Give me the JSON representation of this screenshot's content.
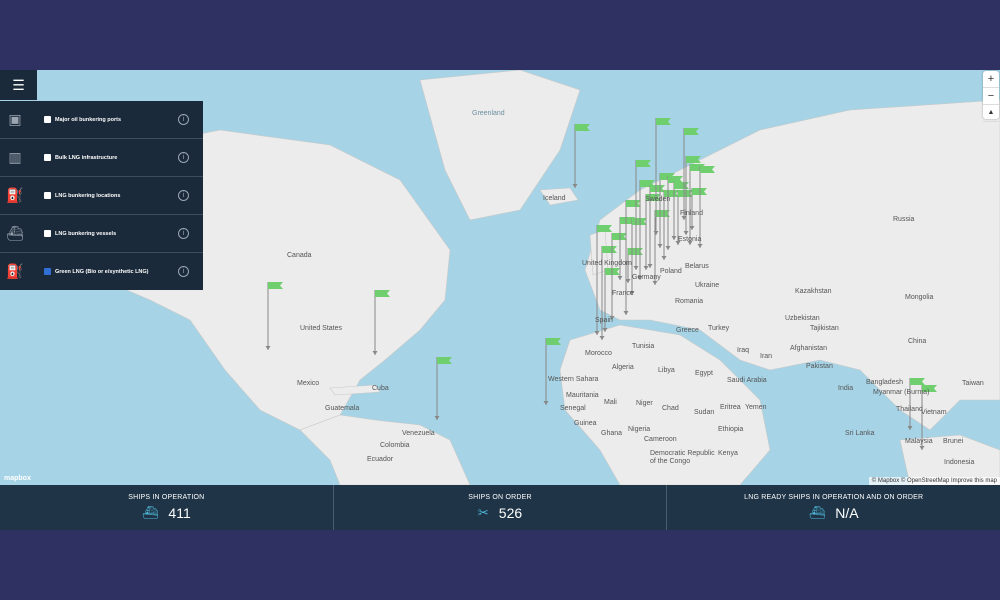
{
  "menu_icon": "hamburger-icon",
  "layers": [
    {
      "icon": "oil-port-icon",
      "label": "Major oil bunkering ports",
      "checked": false,
      "color": "#9aa5b1"
    },
    {
      "icon": "lng-infrastructure-icon",
      "label": "Bulk LNG infrastructure",
      "checked": false,
      "color": "#9aa5b1"
    },
    {
      "icon": "fuel-pump-icon",
      "label": "LNG bunkering locations",
      "checked": false,
      "color": "#9aa5b1"
    },
    {
      "icon": "ship-icon",
      "label": "LNG bunkering vessels",
      "checked": false,
      "color": "#9aa5b1"
    },
    {
      "icon": "green-fuel-pump-icon",
      "label": "Green LNG (Bio or e/synthetic LNG)",
      "checked": true,
      "color": "#4cd864"
    }
  ],
  "zoom": {
    "in": "+",
    "out": "−",
    "reset": "▲"
  },
  "map_labels": {
    "greenland": "Greenland",
    "iceland": "Iceland",
    "canada": "Canada",
    "united_states": "United States",
    "mexico": "Mexico",
    "guatemala": "Guatemala",
    "cuba": "Cuba",
    "venezuela": "Venezuela",
    "colombia": "Colombia",
    "ecuador": "Ecuador",
    "russia": "Russia",
    "finland": "Finland",
    "sweden": "Sweden",
    "estonia": "Estonia",
    "belarus": "Belarus",
    "poland": "Poland",
    "germany": "Germany",
    "france": "France",
    "spain": "Spain",
    "united_kingdom": "United Kingdom",
    "ukraine": "Ukraine",
    "romania": "Romania",
    "greece": "Greece",
    "turkey": "Turkey",
    "kazakhstan": "Kazakhstan",
    "mongolia": "Mongolia",
    "uzbekistan": "Uzbekistan",
    "tajikistan": "Tajikistan",
    "afghanistan": "Afghanistan",
    "pakistan": "Pakistan",
    "china": "China",
    "iraq": "Iraq",
    "iran": "Iran",
    "saudi_arabia": "Saudi Arabia",
    "egypt": "Egypt",
    "libya": "Libya",
    "algeria": "Algeria",
    "tunisia": "Tunisia",
    "morocco": "Morocco",
    "western_sahara": "Western Sahara",
    "mauritania": "Mauritania",
    "mali": "Mali",
    "niger": "Niger",
    "chad": "Chad",
    "sudan": "Sudan",
    "eritrea": "Eritrea",
    "yemen": "Yemen",
    "ethiopia": "Ethiopia",
    "senegal": "Senegal",
    "guinea": "Guinea",
    "ghana": "Ghana",
    "nigeria": "Nigeria",
    "cameroon": "Cameroon",
    "drc": "Democratic Republic of the Congo",
    "kenya": "Kenya",
    "india": "India",
    "sri_lanka": "Sri Lanka",
    "bangladesh": "Bangladesh",
    "myanmar": "Myanmar (Burma)",
    "thailand": "Thailand",
    "vietnam": "Vietnam",
    "taiwan": "Taiwan",
    "malaysia": "Malaysia",
    "brunei": "Brunei",
    "indonesia": "Indonesia"
  },
  "attribution": "© Mapbox © OpenStreetMap Improve this map",
  "logo": "mapbox",
  "stats": [
    {
      "title": "SHIPS IN OPERATION",
      "value": "411",
      "icon": "ship-icon"
    },
    {
      "title": "SHIPS ON ORDER",
      "value": "526",
      "icon": "tools-icon"
    },
    {
      "title": "LNG READY SHIPS IN OPERATION AND ON ORDER",
      "value": "N/A",
      "icon": "lng-ready-ship-icon"
    }
  ],
  "colors": {
    "water": "#a6d4e6",
    "land": "#ececec",
    "panel": "#1b2a3a",
    "stats_bar": "#1f3447",
    "flag": "#6fcf6f",
    "accent": "#4fb8d8"
  }
}
